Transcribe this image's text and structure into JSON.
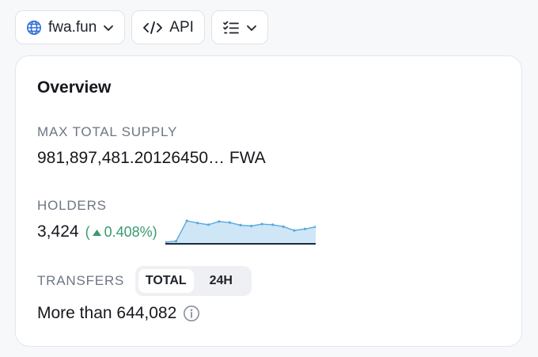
{
  "toolbar": {
    "site_label": "fwa.fun",
    "api_label": "API"
  },
  "overview": {
    "title": "Overview",
    "max_supply": {
      "label": "MAX TOTAL SUPPLY",
      "value": "981,897,481.20126450… FWA"
    },
    "holders": {
      "label": "HOLDERS",
      "value": "3,424",
      "change": "0.408%",
      "trend_direction": "up",
      "sparkline": [
        0.0,
        0.05,
        1.0,
        0.9,
        0.82,
        0.97,
        0.92,
        0.8,
        0.76,
        0.85,
        0.82,
        0.73,
        0.55,
        0.62,
        0.72
      ]
    },
    "transfers": {
      "label": "TRANSFERS",
      "tabs": [
        "TOTAL",
        "24H"
      ],
      "active_tab": "TOTAL",
      "value": "More than 644,082"
    }
  },
  "colors": {
    "positive": "#3b9a6e",
    "sparkline_stroke": "#5aa9dc",
    "sparkline_fill": "#cfe6f7",
    "baseline": "#1c2a3f"
  },
  "icons": [
    "globe-icon",
    "chevron-down-icon",
    "code-icon",
    "list-check-icon",
    "triangle-up-icon",
    "info-icon"
  ]
}
